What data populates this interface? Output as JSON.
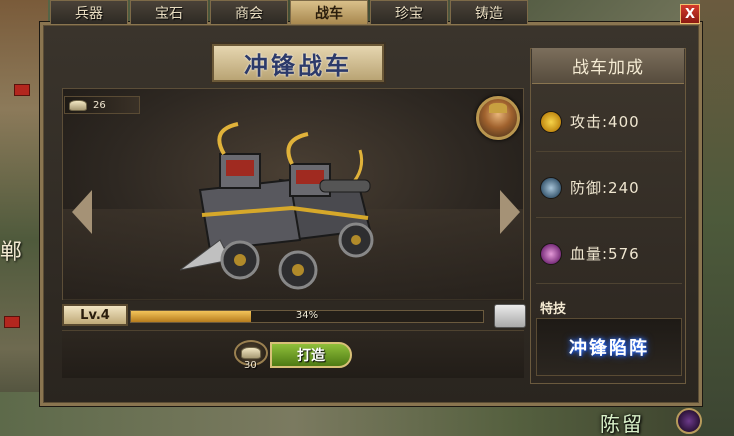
{
  "tabs": [
    {
      "label": "兵器"
    },
    {
      "label": "宝石"
    },
    {
      "label": "商会"
    },
    {
      "label": "战车",
      "active": true
    },
    {
      "label": "珍宝"
    },
    {
      "label": "铸造"
    }
  ],
  "close_label": "X",
  "panel": {
    "title": "冲锋战车",
    "resource_count": "26",
    "level": "Lv.4",
    "progress_percent": 34,
    "progress_text": "34%",
    "forge_cost": "30",
    "forge_label": "打造"
  },
  "stats": {
    "header": "战车加成",
    "attack": "攻击:400",
    "defense": "防御:240",
    "hp": "血量:576",
    "skill_label": "特技",
    "skill_name": "冲锋陷阵"
  },
  "map": {
    "left_char": "郸",
    "city_name": "陈留"
  },
  "colors": {
    "accent_gold": "#d9c08a",
    "button_green": "#6ea02a",
    "close_red": "#c22a1e"
  }
}
